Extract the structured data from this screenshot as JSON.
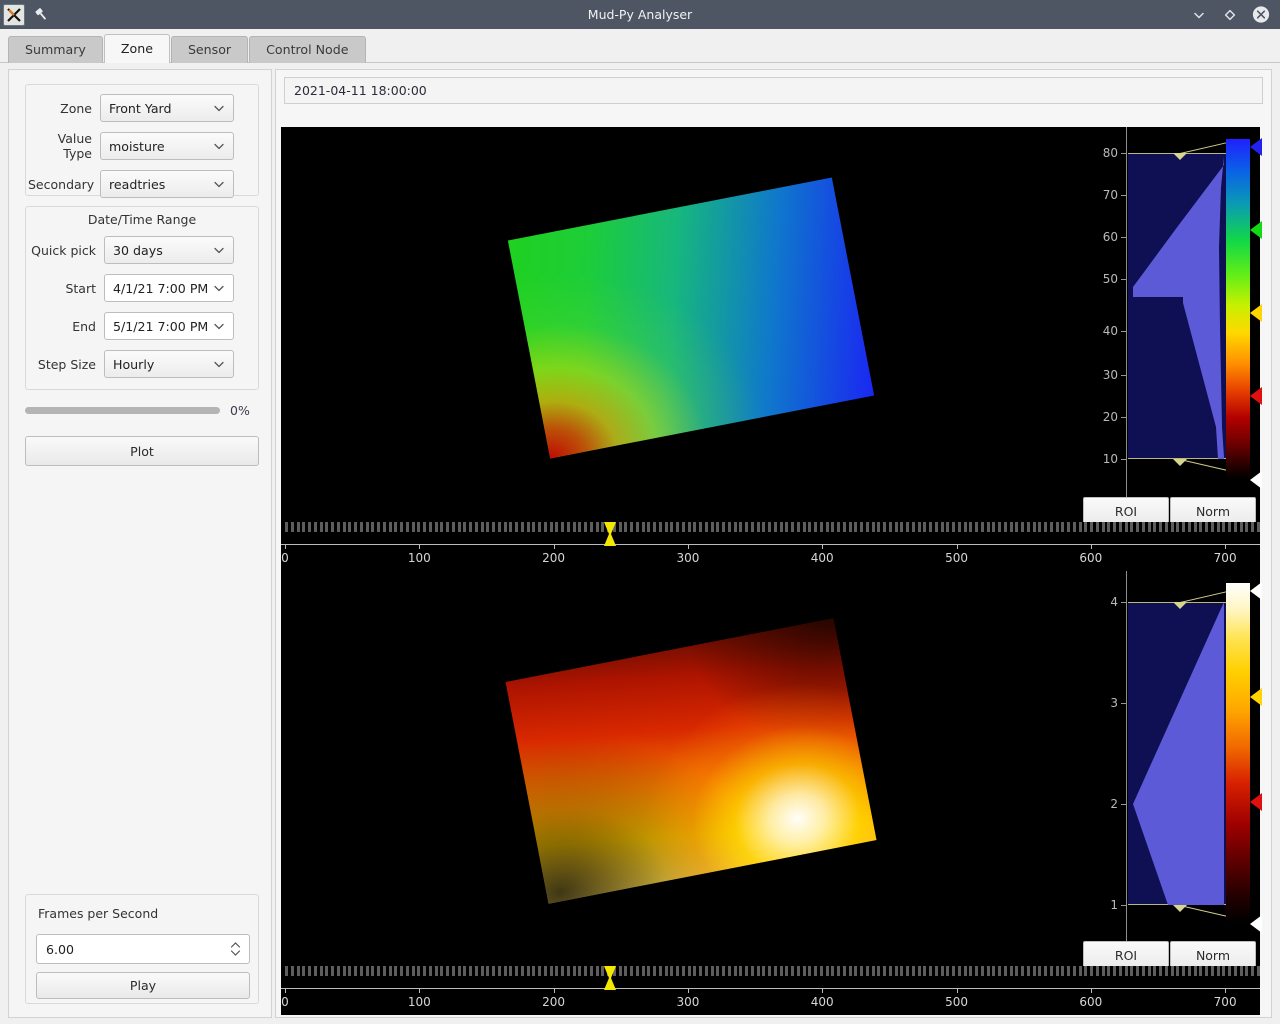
{
  "window": {
    "title": "Mud-Py Analyser",
    "icons": {
      "app": "x11-app-icon",
      "pin": "pin-icon"
    },
    "controls": [
      {
        "name": "minimize-button",
        "glyph": "chevron-down-icon"
      },
      {
        "name": "maximize-button",
        "glyph": "diamond-icon"
      },
      {
        "name": "close-button",
        "glyph": "close-icon"
      }
    ]
  },
  "tabs": [
    {
      "label": "Summary",
      "active": false
    },
    {
      "label": "Zone",
      "active": true
    },
    {
      "label": "Sensor",
      "active": false
    },
    {
      "label": "Control Node",
      "active": false
    }
  ],
  "sidebar": {
    "selectors": [
      {
        "label": "Zone",
        "value": "Front Yard",
        "style": "gray"
      },
      {
        "label": "Value Type",
        "value": "moisture",
        "style": "gray"
      },
      {
        "label": "Secondary",
        "value": "readtries",
        "style": "gray"
      }
    ],
    "daterange": {
      "title": "Date/Time Range",
      "fields": [
        {
          "label": "Quick pick",
          "value": "30 days",
          "style": "gray"
        },
        {
          "label": "Start",
          "value": "4/1/21 7:00 PM",
          "style": "white"
        },
        {
          "label": "End",
          "value": "5/1/21 7:00 PM",
          "style": "white"
        },
        {
          "label": "Step Size",
          "value": "Hourly",
          "style": "gray"
        }
      ]
    },
    "progress": {
      "percent_label": "0%",
      "value": 0
    },
    "plot_button": "Plot",
    "fps": {
      "label": "Frames per Second",
      "value": "6.00"
    },
    "play_button": "Play"
  },
  "main": {
    "timestamp": "2021-04-11 18:00:00",
    "lut_buttons": {
      "roi": "ROI",
      "norm": "Norm"
    }
  },
  "chart_data": [
    {
      "type": "heatmap",
      "title": "moisture",
      "colormap": "jet",
      "colormap_stops": [
        "#000000",
        "#4b0000",
        "#a00000",
        "#e84000",
        "#ffd000",
        "#d8f000",
        "#20e020",
        "#00c080",
        "#0060ff",
        "#2020ff"
      ],
      "histogram": {
        "axis_label": "",
        "ticks": [
          10,
          20,
          30,
          40,
          50,
          60,
          70,
          80
        ],
        "ylim": [
          4,
          84
        ],
        "region": [
          10.0,
          77.8
        ],
        "profile_x": [
          10,
          18,
          22,
          40,
          55,
          62,
          63.5,
          64,
          64.5,
          68,
          72,
          76,
          77.5,
          78
        ],
        "profile_y": [
          0.0,
          0.0,
          0.52,
          0.58,
          0.66,
          0.7,
          0.72,
          0.02,
          0.25,
          0.48,
          0.7,
          0.93,
          1.0,
          0.0
        ]
      },
      "lut_ticks": [
        {
          "value": 82.5,
          "color": "#2222ee",
          "name": "lut-tick-blue"
        },
        {
          "value": 65.0,
          "color": "#14d814",
          "name": "lut-tick-green"
        },
        {
          "value": 45.0,
          "color": "#ffd400",
          "name": "lut-tick-yellow"
        },
        {
          "value": 25.0,
          "color": "#e01010",
          "name": "lut-tick-red"
        },
        {
          "value": 5.5,
          "color": "#ffffff",
          "name": "lut-tick-white"
        }
      ],
      "timeline": {
        "ticks": [
          0,
          100,
          200,
          300,
          400,
          500,
          600,
          700
        ],
        "xlim": [
          0,
          720
        ],
        "marker": 240
      }
    },
    {
      "type": "heatmap",
      "title": "readtries",
      "colormap": "hot",
      "colormap_stops": [
        "#000000",
        "#3a0000",
        "#8a0000",
        "#d02000",
        "#ff7a00",
        "#ffcc00",
        "#fff0a0",
        "#ffffff"
      ],
      "histogram": {
        "axis_label": "",
        "ticks": [
          1,
          2,
          3,
          4
        ],
        "ylim": [
          0.6,
          4.3
        ],
        "region": [
          1.0,
          4.0
        ],
        "profile_x": [
          1.0,
          1.3,
          1.6,
          2.0,
          2.4,
          2.8,
          3.2,
          3.6,
          3.95,
          4.0
        ],
        "profile_y": [
          0.0,
          0.26,
          0.55,
          1.0,
          0.9,
          0.78,
          0.63,
          0.45,
          0.28,
          0.0
        ]
      },
      "lut_ticks": [
        {
          "value": 4.2,
          "color": "#ffffff",
          "name": "lut-tick-white"
        },
        {
          "value": 3.05,
          "color": "#ffd400",
          "name": "lut-tick-yellow"
        },
        {
          "value": 1.9,
          "color": "#e01010",
          "name": "lut-tick-red"
        },
        {
          "value": 0.72,
          "color": "#ffffff",
          "name": "lut-tick-white-low"
        }
      ],
      "timeline": {
        "ticks": [
          0,
          100,
          200,
          300,
          400,
          500,
          600,
          700
        ],
        "xlim": [
          0,
          720
        ],
        "marker": 240
      }
    }
  ]
}
